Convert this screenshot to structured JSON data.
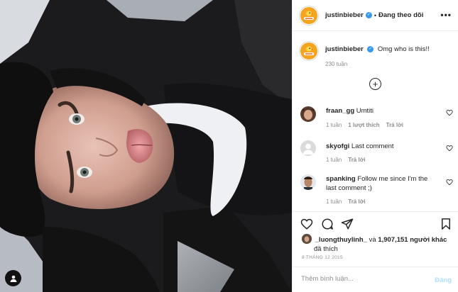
{
  "post": {
    "author": "justinbieber",
    "follow_status": "Đang theo dõi",
    "dot": "•",
    "verified_mark": "✓",
    "more_icon": "more-horizontal-icon"
  },
  "caption": {
    "author": "justinbieber",
    "text": "Omg who is this!!",
    "time": "230 tuần"
  },
  "load_more_icon": "plus-circle-icon",
  "comments": [
    {
      "user": "fraan_gg",
      "text": "Umtiti",
      "time": "1 tuần",
      "likes": "1 lượt thích",
      "reply": "Trả lời"
    },
    {
      "user": "skyofgi",
      "text": "Last comment",
      "time": "1 tuần",
      "reply": "Trả lời"
    },
    {
      "user": "spanking",
      "text": "Follow me since I'm the last comment ;)",
      "time": "1 tuần",
      "reply": "Trả lời"
    }
  ],
  "actions": {
    "like_icon": "heart-icon",
    "comment_icon": "comment-icon",
    "share_icon": "send-icon",
    "save_icon": "bookmark-icon"
  },
  "likes": {
    "user": "_luongthuylinh_",
    "conj": " và ",
    "count": "1,907,151 người khác",
    "suffix": "đã thích"
  },
  "date": "8 THÁNG 12 2015",
  "comment_box": {
    "placeholder": "Thêm bình luận...",
    "post_label": "Đăng"
  },
  "colors": {
    "verified": "#3897f0",
    "muted": "#8e8e8e",
    "post_disabled": "#b2dffc",
    "divider": "#efefef"
  }
}
